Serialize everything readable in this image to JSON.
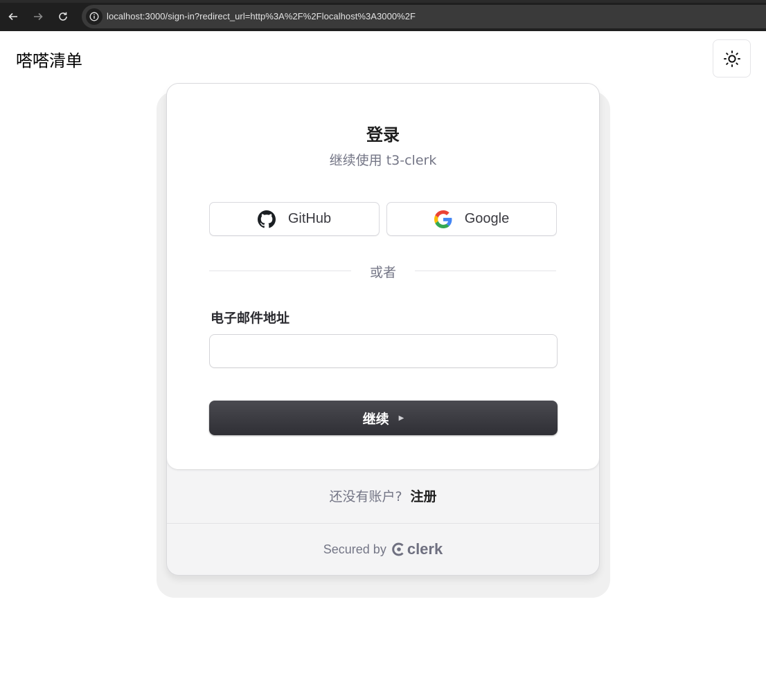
{
  "browser": {
    "url": "localhost:3000/sign-in?redirect_url=http%3A%2F%2Flocalhost%3A3000%2F",
    "back_icon": "arrow-left-icon",
    "forward_icon": "arrow-right-icon",
    "reload_icon": "reload-icon",
    "info_icon": "info-icon"
  },
  "header": {
    "app_title": "嗒嗒清单",
    "theme_icon": "sun-icon"
  },
  "card": {
    "title": "登录",
    "subtitle": "继续使用 t3-clerk",
    "social": [
      {
        "label": "GitHub",
        "icon": "github-icon"
      },
      {
        "label": "Google",
        "icon": "google-icon"
      }
    ],
    "divider_text": "或者",
    "email_label": "电子邮件地址",
    "email_value": "",
    "continue_label": "继续",
    "continue_icon": "triangle-right-icon"
  },
  "footer": {
    "signup_prompt": "还没有账户?",
    "signup_link": "注册",
    "secured_by": "Secured by",
    "brand": "clerk"
  },
  "colors": {
    "primary_button": "#2f2f35",
    "muted_text": "#747686",
    "browser_chrome": "#1f1f1f"
  }
}
